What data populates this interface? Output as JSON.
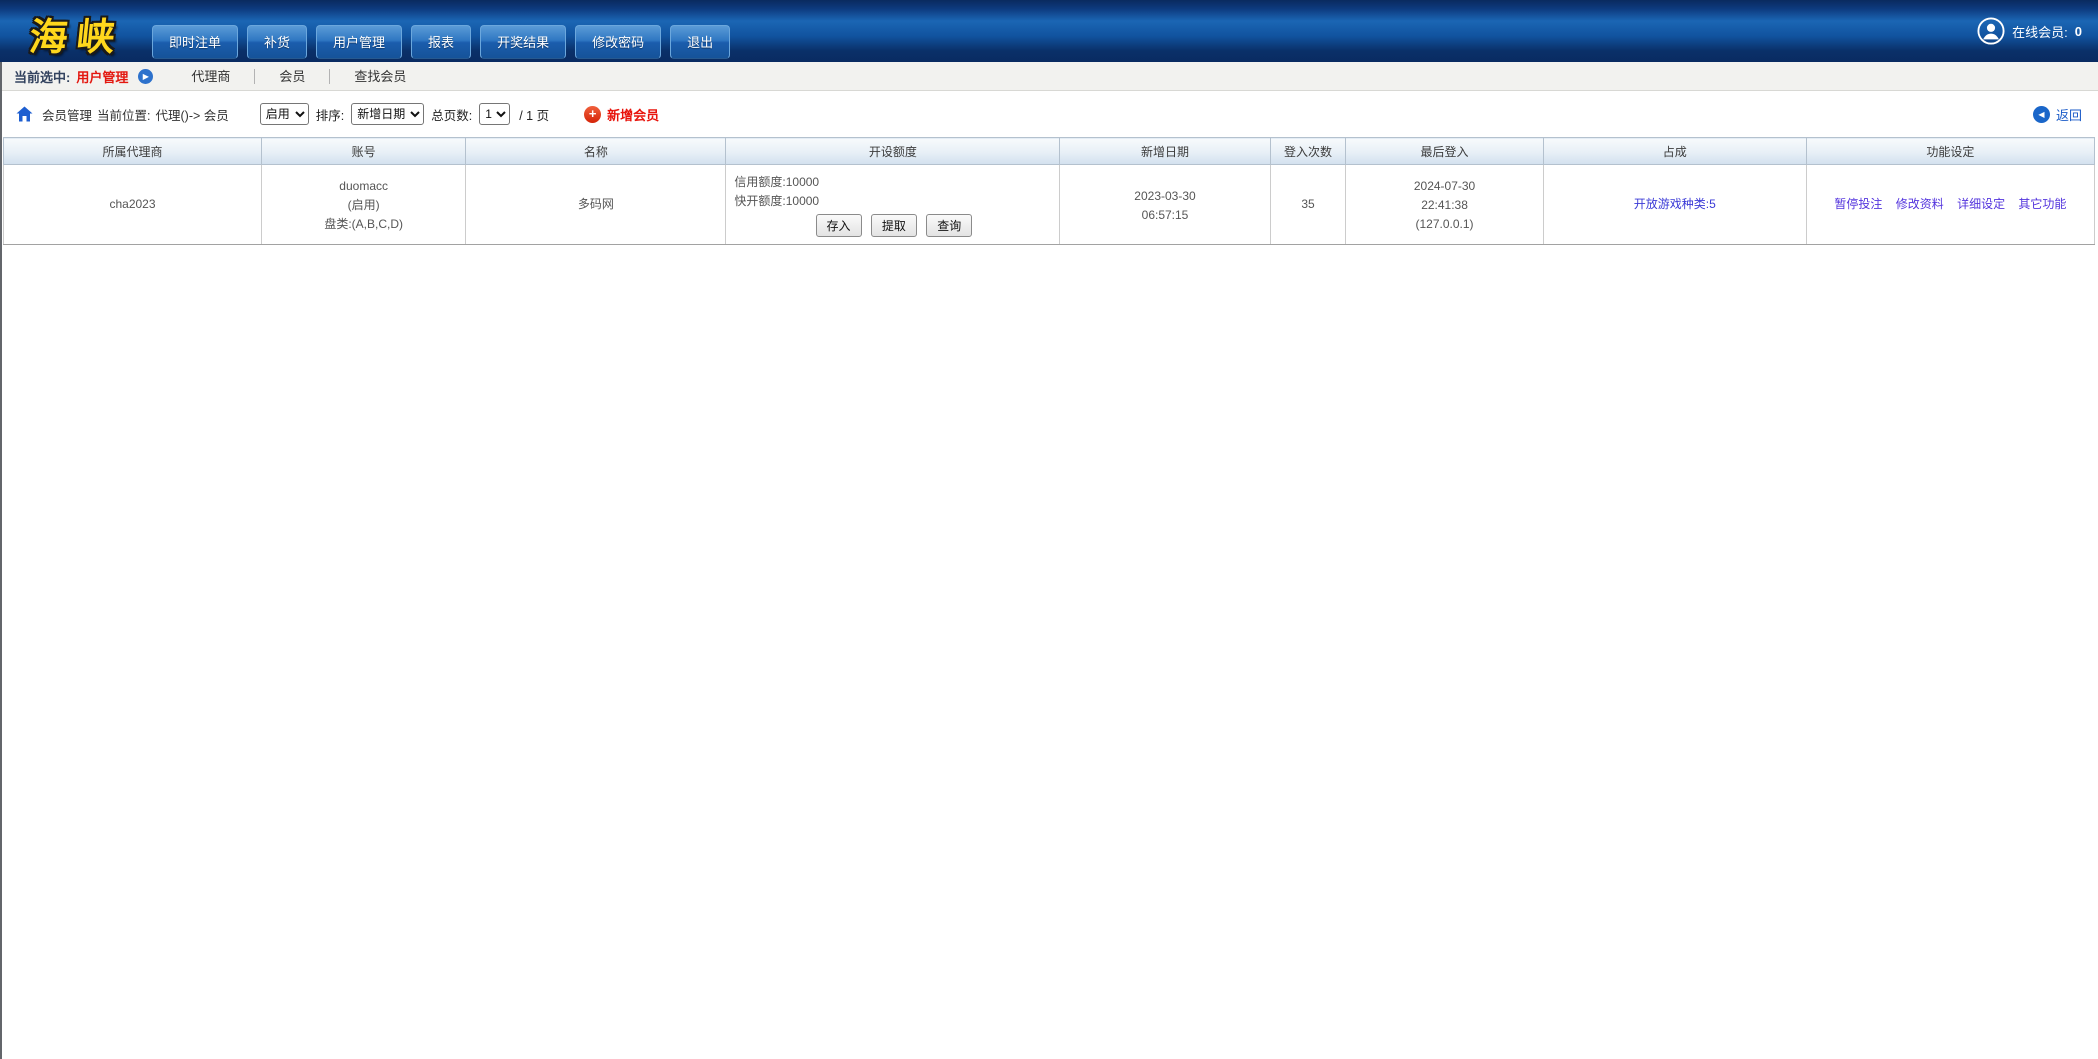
{
  "header": {
    "logo": "海峡",
    "nav": [
      "即时注单",
      "补货",
      "用户管理",
      "报表",
      "开奖结果",
      "修改密码",
      "退出"
    ],
    "online_label": "在线会员:",
    "online_count": "0"
  },
  "subnav": {
    "current_label": "当前选中:",
    "current_value": "用户管理",
    "items": [
      "代理商",
      "会员",
      "查找会员"
    ]
  },
  "toolbar": {
    "section": "会员管理",
    "location_label": "当前位置:",
    "location_value": "代理()-> 会员",
    "status_select": "启用",
    "sort_label": "排序:",
    "sort_select": "新增日期",
    "pages_label": "总页数:",
    "page_select": "1",
    "pages_suffix": "/ 1 页",
    "add_member_label": "新增会员",
    "back_label": "返回"
  },
  "table": {
    "headers": [
      "所属代理商",
      "账号",
      "名称",
      "开设额度",
      "新增日期",
      "登入次数",
      "最后登入",
      "占成",
      "功能设定"
    ],
    "row": {
      "agent": "cha2023",
      "account": "duomacc",
      "account_status": "(启用)",
      "account_pan": "盘类:(A,B,C,D)",
      "name": "多码网",
      "credit_line": "信用额度:10000",
      "quick_line": "快开额度:10000",
      "btn_deposit": "存入",
      "btn_withdraw": "提取",
      "btn_query": "查询",
      "created_date": "2023-03-30",
      "created_time": "06:57:15",
      "login_count": "35",
      "last_date": "2024-07-30",
      "last_time": "22:41:38",
      "last_ip": "(127.0.0.1)",
      "share": "开放游戏种类:5",
      "actions": [
        "暂停投注",
        "修改资料",
        "详细设定",
        "其它功能"
      ]
    }
  },
  "colors": {
    "header_blue": "#11539f",
    "accent_red": "#e8140c",
    "logo_yellow": "#ffd71c",
    "share_link_blue": "#3a39d6",
    "action_link_purple": "#5334dd",
    "back_link_blue": "#1a5bc8"
  }
}
